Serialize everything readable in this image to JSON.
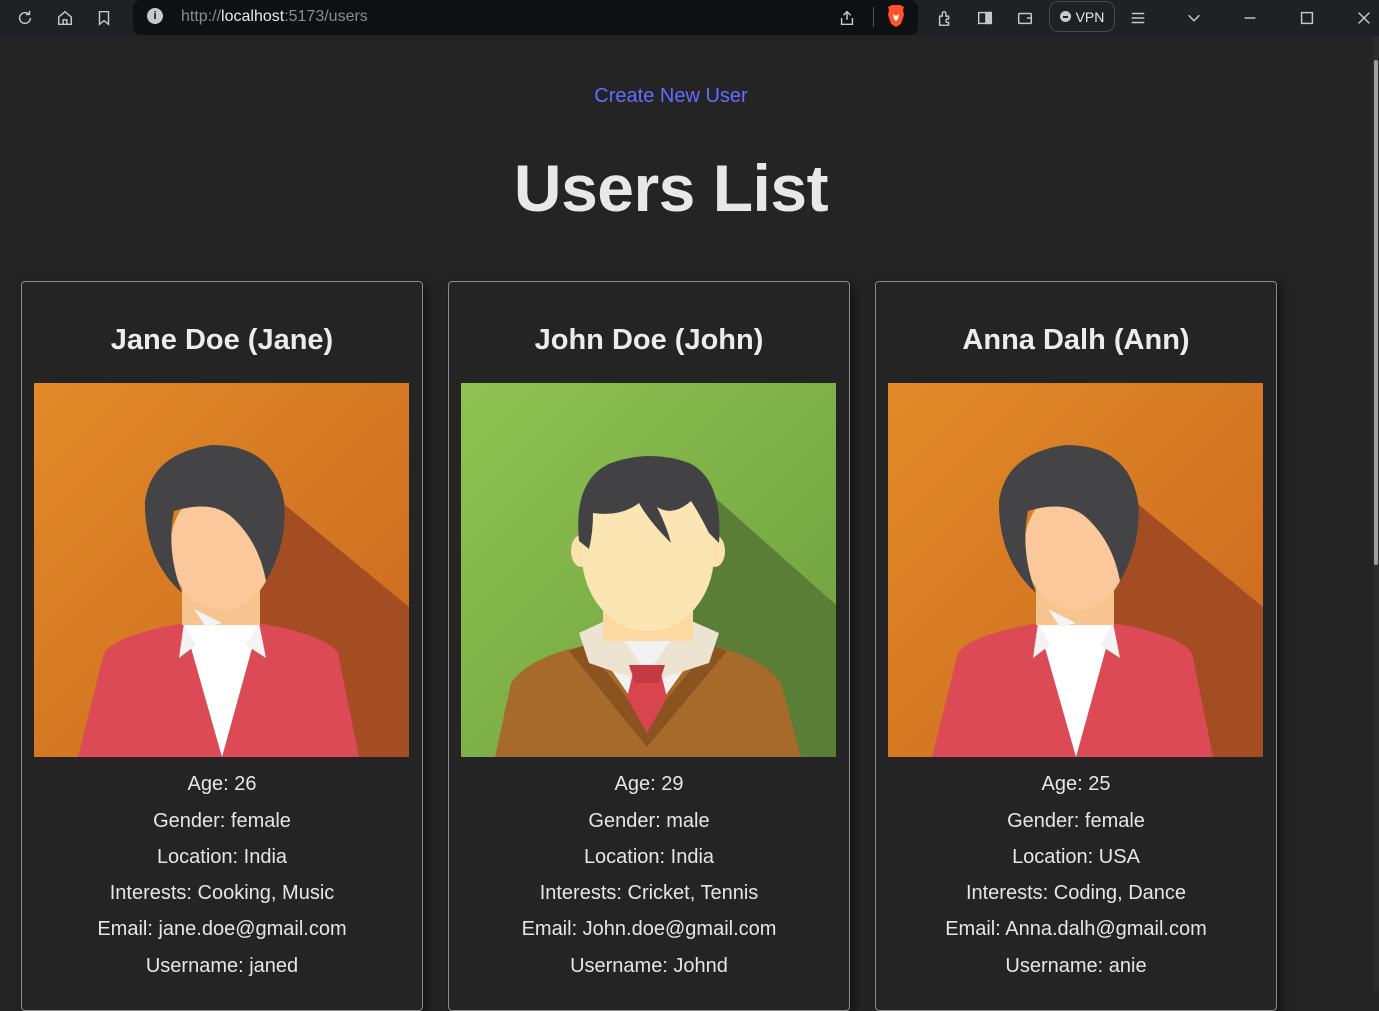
{
  "browser": {
    "url_scheme": "http://",
    "url_host": "localhost",
    "url_path": ":5173/users",
    "vpn_label": "VPN"
  },
  "page": {
    "create_link": "Create New User",
    "title": "Users List"
  },
  "users": [
    {
      "name": "Jane Doe (Jane)",
      "avatar_icon": "female-avatar-icon",
      "age": "Age: 26",
      "gender": "Gender: female",
      "location": "Location: India",
      "interests": "Interests: Cooking, Music",
      "email": "Email: jane.doe@gmail.com",
      "username": "Username: janed"
    },
    {
      "name": "John Doe (John)",
      "avatar_icon": "male-avatar-icon",
      "age": "Age: 29",
      "gender": "Gender: male",
      "location": "Location: India",
      "interests": "Interests: Cricket, Tennis",
      "email": "Email: John.doe@gmail.com",
      "username": "Username: Johnd"
    },
    {
      "name": "Anna Dalh (Ann)",
      "avatar_icon": "female-avatar-icon",
      "age": "Age: 25",
      "gender": "Gender: female",
      "location": "Location: USA",
      "interests": "Interests: Coding, Dance",
      "email": "Email: Anna.dalh@gmail.com",
      "username": "Username: anie"
    }
  ],
  "colors": {
    "link": "#646cff",
    "background": "#242424",
    "female_bg": "#e08828",
    "male_bg": "#8cc152"
  }
}
